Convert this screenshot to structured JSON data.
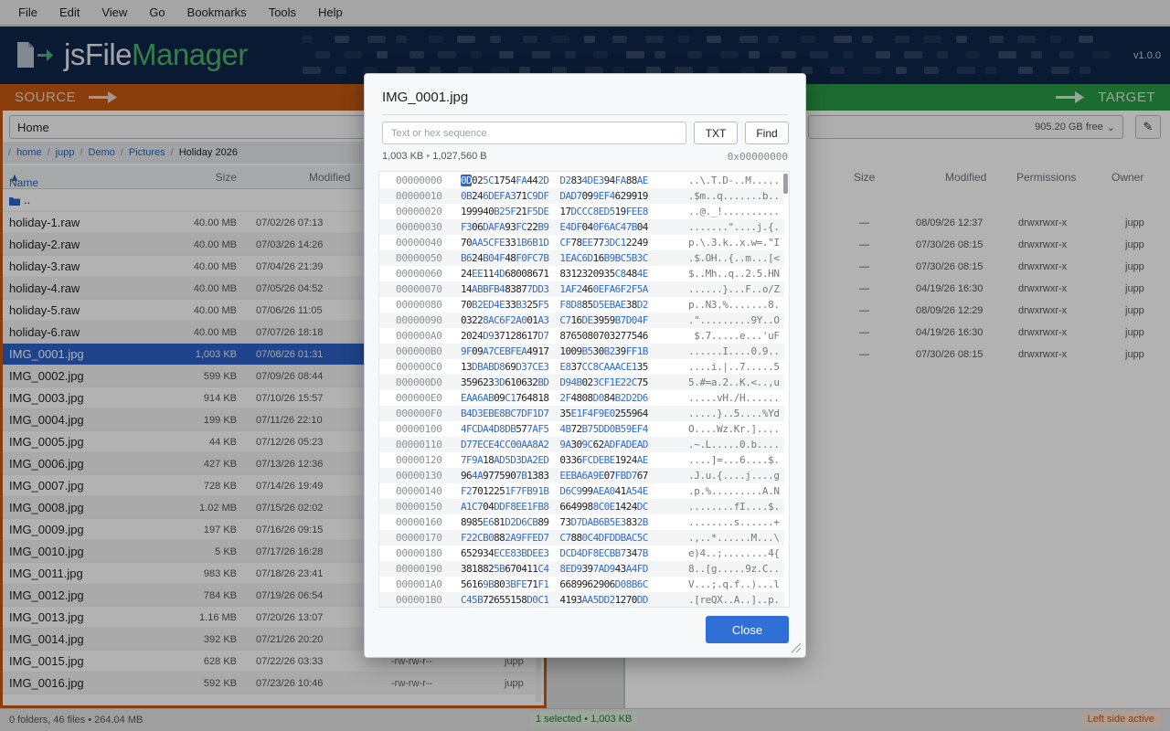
{
  "menu": [
    "File",
    "Edit",
    "View",
    "Go",
    "Bookmarks",
    "Tools",
    "Help"
  ],
  "app": {
    "logo_js": "js",
    "logo_file": "File",
    "logo_manager": "Manager",
    "version": "v1.0.0"
  },
  "source": {
    "label": "SOURCE",
    "drive": "Home",
    "breadcrumbs": [
      "home",
      "jupp",
      "Demo",
      "Pictures",
      "Holiday 2026"
    ],
    "columns": {
      "name": "Name",
      "size": "Size",
      "modified": "Modified"
    },
    "parent": "..",
    "files": [
      {
        "name": "holiday-1.raw",
        "size": "40.00 MB",
        "modified": "07/02/26 07:13"
      },
      {
        "name": "holiday-2.raw",
        "size": "40.00 MB",
        "modified": "07/03/26 14:26"
      },
      {
        "name": "holiday-3.raw",
        "size": "40.00 MB",
        "modified": "07/04/26 21:39"
      },
      {
        "name": "holiday-4.raw",
        "size": "40.00 MB",
        "modified": "07/05/26 04:52"
      },
      {
        "name": "holiday-5.raw",
        "size": "40.00 MB",
        "modified": "07/06/26 11:05"
      },
      {
        "name": "holiday-6.raw",
        "size": "40.00 MB",
        "modified": "07/07/26 18:18"
      },
      {
        "name": "IMG_0001.jpg",
        "size": "1,003 KB",
        "modified": "07/08/26 01:31"
      },
      {
        "name": "IMG_0002.jpg",
        "size": "599 KB",
        "modified": "07/09/26 08:44"
      },
      {
        "name": "IMG_0003.jpg",
        "size": "914 KB",
        "modified": "07/10/26 15:57"
      },
      {
        "name": "IMG_0004.jpg",
        "size": "199 KB",
        "modified": "07/11/26 22:10"
      },
      {
        "name": "IMG_0005.jpg",
        "size": "44 KB",
        "modified": "07/12/26 05:23"
      },
      {
        "name": "IMG_0006.jpg",
        "size": "427 KB",
        "modified": "07/13/26 12:36"
      },
      {
        "name": "IMG_0007.jpg",
        "size": "728 KB",
        "modified": "07/14/26 19:49"
      },
      {
        "name": "IMG_0008.jpg",
        "size": "1.02 MB",
        "modified": "07/15/26 02:02"
      },
      {
        "name": "IMG_0009.jpg",
        "size": "197 KB",
        "modified": "07/16/26 09:15"
      },
      {
        "name": "IMG_0010.jpg",
        "size": "5 KB",
        "modified": "07/17/26 16:28"
      },
      {
        "name": "IMG_0011.jpg",
        "size": "983 KB",
        "modified": "07/18/26 23:41"
      },
      {
        "name": "IMG_0012.jpg",
        "size": "784 KB",
        "modified": "07/19/26 06:54"
      },
      {
        "name": "IMG_0013.jpg",
        "size": "1.16 MB",
        "modified": "07/20/26 13:07"
      },
      {
        "name": "IMG_0014.jpg",
        "size": "392 KB",
        "modified": "07/21/26 20:20"
      },
      {
        "name": "IMG_0015.jpg",
        "size": "628 KB",
        "modified": "07/22/26 03:33",
        "perm": "-rw-rw-r--",
        "owner": "jupp"
      },
      {
        "name": "IMG_0016.jpg",
        "size": "592 KB",
        "modified": "07/23/26 10:46",
        "perm": "-rw-rw-r--",
        "owner": "jupp"
      }
    ],
    "selected_index": 6
  },
  "target": {
    "label": "TARGET",
    "free": "905.20 GB free",
    "columns": {
      "size": "Size",
      "modified": "Modified",
      "permissions": "Permissions",
      "owner": "Owner"
    },
    "rows": [
      {
        "size": "—",
        "modified": "08/09/26 12:37",
        "perm": "drwxrwxr-x",
        "owner": "jupp"
      },
      {
        "size": "—",
        "modified": "07/30/26 08:15",
        "perm": "drwxrwxr-x",
        "owner": "jupp"
      },
      {
        "size": "—",
        "modified": "07/30/26 08:15",
        "perm": "drwxrwxr-x",
        "owner": "jupp"
      },
      {
        "size": "—",
        "modified": "04/19/26 16:30",
        "perm": "drwxrwxr-x",
        "owner": "jupp"
      },
      {
        "size": "—",
        "modified": "08/09/26 12:29",
        "perm": "drwxrwxr-x",
        "owner": "jupp"
      },
      {
        "size": "—",
        "modified": "04/19/26 16:30",
        "perm": "drwxrwxr-x",
        "owner": "jupp"
      },
      {
        "size": "—",
        "modified": "07/30/26 08:15",
        "perm": "drwxrwxr-x",
        "owner": "jupp"
      }
    ]
  },
  "dialog": {
    "title": "IMG_0001.jpg",
    "search_placeholder": "Text or hex sequence",
    "txt_label": "TXT",
    "find_label": "Find",
    "size_kb": "1,003 KB",
    "size_bytes": "1,027,560 B",
    "offset": "0x00000000",
    "close_label": "Close",
    "hex_rows": [
      {
        "off": "00000000",
        "bytes": [
          "0D",
          "02",
          "5C",
          "17",
          "54",
          "FA",
          "44",
          "2D",
          "D2",
          "83",
          "4D",
          "E3",
          "94",
          "FA",
          "88",
          "AE"
        ],
        "ascii": "..\\.T.D-..M....."
      },
      {
        "off": "00000010",
        "bytes": [
          "0B",
          "24",
          "6D",
          "EF",
          "A3",
          "71",
          "C9",
          "DF",
          "DA",
          "D7",
          "09",
          "9E",
          "F4",
          "62",
          "99",
          "19"
        ],
        "ascii": ".$m..q.......b.."
      },
      {
        "off": "00000020",
        "bytes": [
          "19",
          "99",
          "40",
          "B2",
          "5F",
          "21",
          "F5",
          "DE",
          "17",
          "DC",
          "CC",
          "8E",
          "D5",
          "19",
          "FE",
          "E8"
        ],
        "ascii": "..@._!.........."
      },
      {
        "off": "00000030",
        "bytes": [
          "F3",
          "06",
          "DA",
          "FA",
          "93",
          "FC",
          "22",
          "B9",
          "E4",
          "DF",
          "04",
          "0F",
          "6A",
          "C4",
          "7B",
          "04"
        ],
        "ascii": ".......\"....j.{."
      },
      {
        "off": "00000040",
        "bytes": [
          "70",
          "AA",
          "5C",
          "FE",
          "33",
          "1B",
          "6B",
          "1D",
          "CF",
          "78",
          "EE",
          "77",
          "3D",
          "C1",
          "22",
          "49"
        ],
        "ascii": "p.\\.3.k..x.w=.\"I"
      },
      {
        "off": "00000050",
        "bytes": [
          "B6",
          "24",
          "B0",
          "4F",
          "48",
          "F0",
          "FC",
          "7B",
          "1E",
          "AC",
          "6D",
          "16",
          "B9",
          "BC",
          "5B",
          "3C"
        ],
        "ascii": ".$.OH..{..m...[<"
      },
      {
        "off": "00000060",
        "bytes": [
          "24",
          "EE",
          "11",
          "4D",
          "68",
          "00",
          "86",
          "71",
          "83",
          "12",
          "32",
          "09",
          "35",
          "C8",
          "48",
          "4E"
        ],
        "ascii": "$..Mh..q..2.5.HN"
      },
      {
        "off": "00000070",
        "bytes": [
          "14",
          "AB",
          "BF",
          "B4",
          "83",
          "87",
          "7D",
          "D3",
          "1A",
          "F2",
          "46",
          "0E",
          "FA",
          "6F",
          "2F",
          "5A"
        ],
        "ascii": "......}...F..o/Z"
      },
      {
        "off": "00000080",
        "bytes": [
          "70",
          "B2",
          "ED",
          "4E",
          "33",
          "B3",
          "25",
          "F5",
          "F8",
          "D8",
          "85",
          "D5",
          "EB",
          "AE",
          "38",
          "D2"
        ],
        "ascii": "p..N3.%.......8."
      },
      {
        "off": "00000090",
        "bytes": [
          "03",
          "22",
          "8A",
          "C6",
          "F2",
          "A0",
          "01",
          "A3",
          "C7",
          "16",
          "DE",
          "39",
          "59",
          "B7",
          "D0",
          "4F"
        ],
        "ascii": ".\".........9Y..O"
      },
      {
        "off": "000000A0",
        "bytes": [
          "20",
          "24",
          "D9",
          "37",
          "12",
          "86",
          "17",
          "D7",
          "87",
          "65",
          "08",
          "07",
          "03",
          "27",
          "75",
          "46"
        ],
        "ascii": " $.7.....e...'uF"
      },
      {
        "off": "000000B0",
        "bytes": [
          "9F",
          "09",
          "A7",
          "CE",
          "BF",
          "EA",
          "49",
          "17",
          "10",
          "09",
          "B5",
          "30",
          "B2",
          "39",
          "FF",
          "1B"
        ],
        "ascii": "......I....0.9.."
      },
      {
        "off": "000000C0",
        "bytes": [
          "13",
          "DB",
          "AB",
          "D8",
          "69",
          "D3",
          "7C",
          "E3",
          "E8",
          "37",
          "CC",
          "8C",
          "AA",
          "AC",
          "E1",
          "35"
        ],
        "ascii": "....i.|..7.....5"
      },
      {
        "off": "000000D0",
        "bytes": [
          "35",
          "96",
          "23",
          "3D",
          "61",
          "06",
          "32",
          "BD",
          "D9",
          "4B",
          "02",
          "3C",
          "F1",
          "E2",
          "2C",
          "75"
        ],
        "ascii": "5.#=a.2..K.<..,u"
      },
      {
        "off": "000000E0",
        "bytes": [
          "EA",
          "A6",
          "AB",
          "09",
          "C1",
          "76",
          "48",
          "18",
          "2F",
          "48",
          "08",
          "D0",
          "84",
          "B2",
          "D2",
          "D6"
        ],
        "ascii": ".....vH./H......"
      },
      {
        "off": "000000F0",
        "bytes": [
          "B4",
          "D3",
          "EB",
          "E8",
          "BC",
          "7D",
          "F1",
          "D7",
          "35",
          "E1",
          "F4",
          "F9",
          "E0",
          "25",
          "59",
          "64"
        ],
        "ascii": ".....}..5....%Yd"
      },
      {
        "off": "00000100",
        "bytes": [
          "4F",
          "CD",
          "A4",
          "D8",
          "DB",
          "57",
          "7A",
          "F5",
          "4B",
          "72",
          "B7",
          "5D",
          "D0",
          "B5",
          "9E",
          "F4"
        ],
        "ascii": "O....Wz.Kr.]...."
      },
      {
        "off": "00000110",
        "bytes": [
          "D7",
          "7E",
          "CE",
          "4C",
          "C0",
          "0A",
          "A8",
          "A2",
          "9A",
          "30",
          "9C",
          "62",
          "AD",
          "FA",
          "DE",
          "AD"
        ],
        "ascii": ".~.L.....0.b...."
      },
      {
        "off": "00000120",
        "bytes": [
          "7F",
          "9A",
          "18",
          "AD",
          "5D",
          "3D",
          "A2",
          "ED",
          "03",
          "36",
          "FC",
          "DE",
          "BE",
          "19",
          "24",
          "AE"
        ],
        "ascii": "....]=...6....$."
      },
      {
        "off": "00000130",
        "bytes": [
          "96",
          "4A",
          "97",
          "75",
          "90",
          "7B",
          "13",
          "83",
          "EE",
          "BA",
          "6A",
          "9E",
          "07",
          "FB",
          "D7",
          "67"
        ],
        "ascii": ".J.u.{....j....g"
      },
      {
        "off": "00000140",
        "bytes": [
          "F2",
          "70",
          "12",
          "25",
          "1F",
          "7F",
          "B9",
          "1B",
          "D6",
          "C9",
          "99",
          "AE",
          "A0",
          "41",
          "A5",
          "4E"
        ],
        "ascii": ".p.%.........A.N"
      },
      {
        "off": "00000150",
        "bytes": [
          "A1",
          "C7",
          "04",
          "DD",
          "F8",
          "EE",
          "1F",
          "B8",
          "66",
          "49",
          "98",
          "8C",
          "0E",
          "14",
          "24",
          "DC"
        ],
        "ascii": "........fI....$."
      },
      {
        "off": "00000160",
        "bytes": [
          "89",
          "85",
          "E6",
          "81",
          "D2",
          "D6",
          "CB",
          "89",
          "73",
          "D7",
          "DA",
          "B6",
          "B5",
          "E3",
          "83",
          "2B"
        ],
        "ascii": "........s......+"
      },
      {
        "off": "00000170",
        "bytes": [
          "F2",
          "2C",
          "B0",
          "88",
          "2A",
          "9F",
          "FE",
          "D7",
          "C7",
          "88",
          "0C",
          "4D",
          "FD",
          "DB",
          "AC",
          "5C"
        ],
        "ascii": ".,..*......M...\\"
      },
      {
        "off": "00000180",
        "bytes": [
          "65",
          "29",
          "34",
          "EC",
          "E8",
          "3B",
          "DE",
          "E3",
          "DC",
          "D4",
          "DF",
          "8E",
          "CB",
          "B7",
          "34",
          "7B"
        ],
        "ascii": "e)4..;........4{"
      },
      {
        "off": "00000190",
        "bytes": [
          "38",
          "18",
          "82",
          "5B",
          "67",
          "04",
          "11",
          "C4",
          "8E",
          "D9",
          "39",
          "7A",
          "D9",
          "43",
          "A4",
          "FD"
        ],
        "ascii": "8..[g.....9z.C.."
      },
      {
        "off": "000001A0",
        "bytes": [
          "56",
          "16",
          "9B",
          "80",
          "3B",
          "FE",
          "71",
          "F1",
          "66",
          "89",
          "96",
          "29",
          "06",
          "D0",
          "8B",
          "6C"
        ],
        "ascii": "V...;.q.f..)...l"
      },
      {
        "off": "000001B0",
        "bytes": [
          "C4",
          "5B",
          "72",
          "65",
          "51",
          "58",
          "D0",
          "C1",
          "41",
          "93",
          "AA",
          "5D",
          "D2",
          "12",
          "70",
          "DD"
        ],
        "ascii": ".[reQX..A..]..p."
      }
    ]
  },
  "status": {
    "left": "0 folders, 46 files  •  264.04 MB",
    "center": "1 selected  •  1,003 KB",
    "right": "Left side active"
  },
  "colors": {
    "source": "#c55a12",
    "target": "#2a9a46",
    "banner": "#10264a",
    "accent": "#2f62c7"
  }
}
